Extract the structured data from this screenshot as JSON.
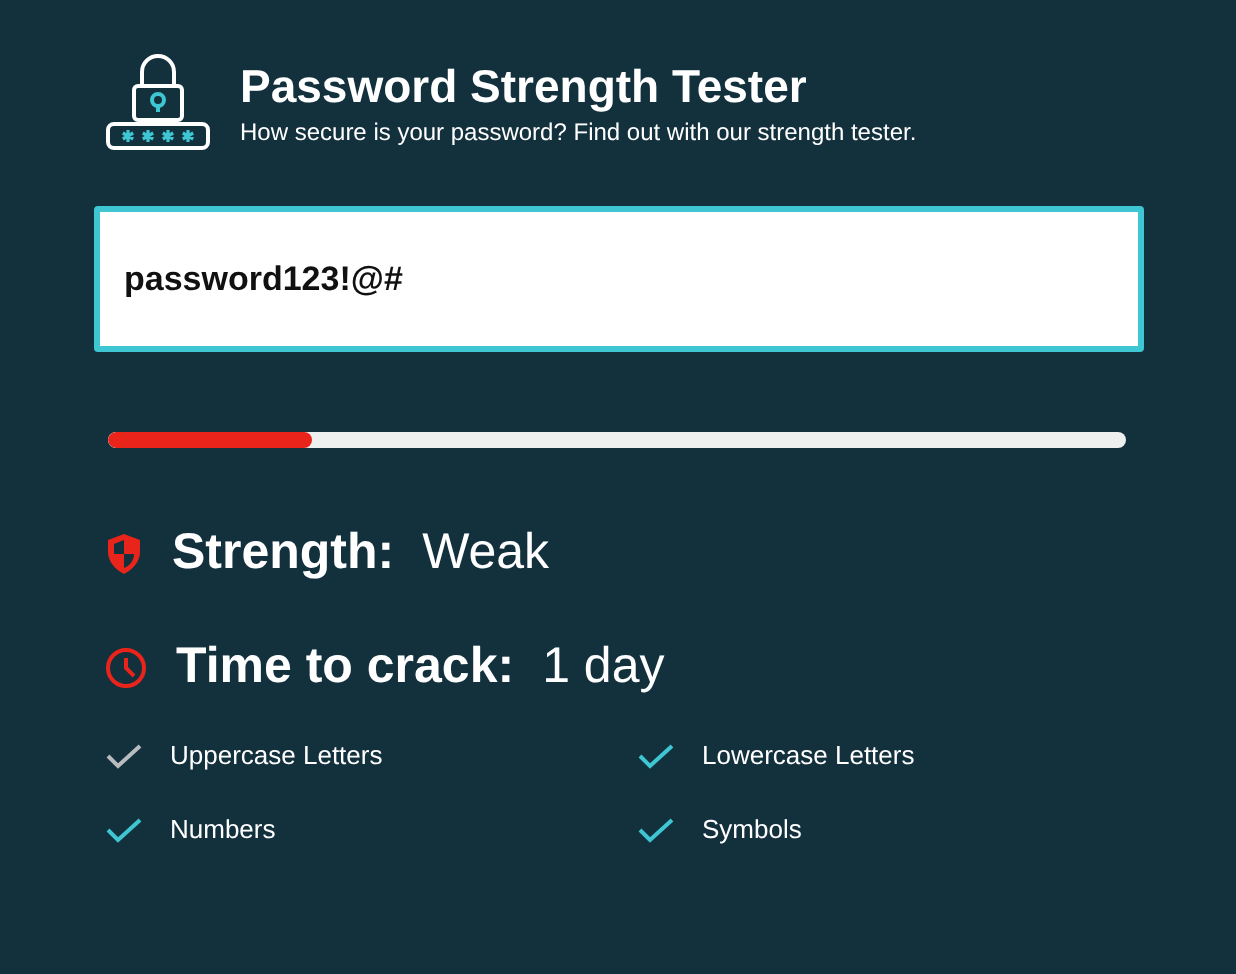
{
  "header": {
    "title": "Password Strength Tester",
    "subtitle": "How secure is your password? Find out with our strength tester."
  },
  "password_field": {
    "value": "password123!@#"
  },
  "strength_meter": {
    "level": 0.2
  },
  "results": [
    {
      "kind": "strength",
      "label": "Strength:",
      "value": "Weak"
    },
    {
      "kind": "time",
      "label": "Time to crack:",
      "value": "1 day"
    }
  ],
  "criteria": [
    {
      "label": "Uppercase Letters",
      "checked": false
    },
    {
      "label": "Lowercase Letters",
      "checked": true
    },
    {
      "label": "Numbers",
      "checked": true
    },
    {
      "label": "Symbols",
      "checked": true
    }
  ]
}
